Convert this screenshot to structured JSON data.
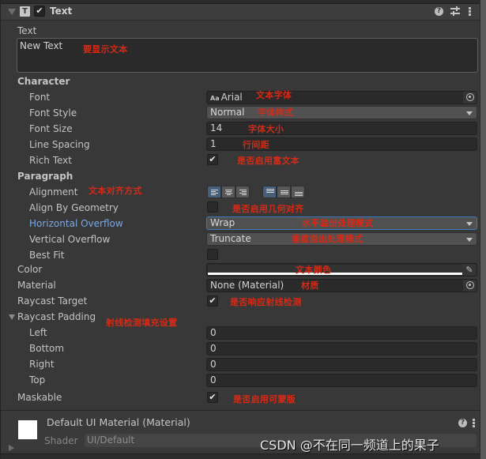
{
  "component": {
    "title": "Text",
    "enabled": true,
    "icons": [
      "fold-arrow-icon",
      "text-component-icon",
      "help-icon",
      "preset-icon",
      "more-menu-icon"
    ]
  },
  "text_field": {
    "label": "Text",
    "value": "New Text",
    "annotation": "要显示文本"
  },
  "character": {
    "header": "Character",
    "font": {
      "label": "Font",
      "value": "Arial",
      "prefix": "Aa",
      "annotation": "文本字体"
    },
    "font_style": {
      "label": "Font Style",
      "value": "Normal",
      "annotation": "字体样式"
    },
    "font_size": {
      "label": "Font Size",
      "value": "14",
      "annotation": "字体大小"
    },
    "line_spacing": {
      "label": "Line Spacing",
      "value": "1",
      "annotation": "行间距"
    },
    "rich_text": {
      "label": "Rich Text",
      "checked": true,
      "check_glyph": "✔",
      "annotation": "是否启用富文本"
    }
  },
  "paragraph": {
    "header": "Paragraph",
    "alignment": {
      "label": "Alignment",
      "annotation": "文本对齐方式",
      "horizontal": [
        "left",
        "center",
        "right"
      ],
      "horizontal_selected": "left",
      "vertical": [
        "top",
        "middle",
        "bottom"
      ],
      "vertical_selected": "top"
    },
    "align_by_geometry": {
      "label": "Align By Geometry",
      "checked": false,
      "annotation": "是否启用几何对齐"
    },
    "horizontal_overflow": {
      "label": "Horizontal Overflow",
      "value": "Wrap",
      "annotation": "水平溢出处理模式"
    },
    "vertical_overflow": {
      "label": "Vertical Overflow",
      "value": "Truncate",
      "annotation": "垂直溢出处理模式"
    },
    "best_fit": {
      "label": "Best Fit",
      "checked": false
    }
  },
  "color": {
    "label": "Color",
    "value": "#323232",
    "alpha_bar": "#ffffff",
    "annotation": "文本颜色"
  },
  "material": {
    "label": "Material",
    "value": "None (Material)",
    "annotation": "材质"
  },
  "raycast_target": {
    "label": "Raycast Target",
    "checked": true,
    "check_glyph": "✔",
    "annotation": "是否响应射线检测"
  },
  "raycast_padding": {
    "label": "Raycast Padding",
    "annotation": "射线检测填充设置",
    "fields": [
      {
        "label": "Left",
        "value": "0"
      },
      {
        "label": "Bottom",
        "value": "0"
      },
      {
        "label": "Right",
        "value": "0"
      },
      {
        "label": "Top",
        "value": "0"
      }
    ]
  },
  "maskable": {
    "label": "Maskable",
    "checked": true,
    "check_glyph": "✔",
    "annotation": "是否启用可蒙版"
  },
  "material_preview": {
    "title": "Default UI Material (Material)",
    "shader_label": "Shader",
    "shader_value": "UI/Default",
    "help_glyph": "?"
  },
  "watermark": "CSDN @不在同一频道上的果子",
  "colors": {
    "background": "#383838",
    "annotation_red": "#d62a16",
    "focus_blue": "#3a79bb",
    "label_blue": "#7ba9e6",
    "selected_toggle": "#46607c"
  }
}
